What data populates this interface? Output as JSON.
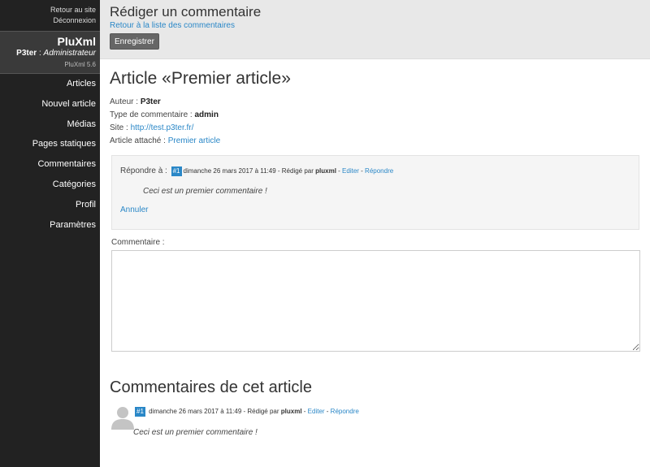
{
  "sidebar": {
    "back_to_site": "Retour au site",
    "logout": "Déconnexion",
    "site_name": "PluXml",
    "user_name": "P3ter",
    "user_sep": " : ",
    "user_role": "Administrateur",
    "version": "PluXml 5.6",
    "menu": [
      {
        "label": "Articles"
      },
      {
        "label": "Nouvel article"
      },
      {
        "label": "Médias"
      },
      {
        "label": "Pages statiques"
      },
      {
        "label": "Commentaires"
      },
      {
        "label": "Catégories"
      },
      {
        "label": "Profil"
      },
      {
        "label": "Paramètres"
      }
    ]
  },
  "header": {
    "title": "Rédiger un commentaire",
    "back_link": "Retour à la liste des commentaires",
    "save_label": "Enregistrer"
  },
  "article": {
    "title": "Article «Premier article»",
    "author_label": "Auteur : ",
    "author": "P3ter",
    "type_label": "Type de commentaire : ",
    "type": "admin",
    "site_label": "Site : ",
    "site": "http://test.p3ter.fr/",
    "attached_label": "Article attaché : ",
    "attached": "Premier article"
  },
  "reply": {
    "label": "Répondre à : ",
    "tag": "#1",
    "date": "dimanche 26 mars 2017 à 11:49 - Rédigé par ",
    "author": "pluxml",
    "sep1": " - ",
    "edit": "Editer",
    "sep2": " - ",
    "reply": "Répondre",
    "text": "Ceci est un premier commentaire !",
    "cancel": "Annuler"
  },
  "form": {
    "comment_label": "Commentaire :",
    "comment_value": ""
  },
  "comments_section": {
    "title": "Commentaires de cet article",
    "items": [
      {
        "tag": "#1",
        "date": "dimanche 26 mars 2017 à 11:49 - Rédigé par ",
        "author": "pluxml",
        "sep1": " - ",
        "edit": "Editer",
        "sep2": " - ",
        "reply": "Répondre",
        "text": "Ceci est un premier commentaire !"
      }
    ]
  },
  "colors": {
    "sidebar_bg": "#222222",
    "profile_bg": "#3a3a3a",
    "header_bg": "#e8e8e8",
    "link": "#2a87c7",
    "tag_bg": "#2a87c7",
    "button_bg": "#666666"
  },
  "icons": {
    "avatar": "user-silhouette-icon",
    "resize": "resize-grip-icon"
  }
}
